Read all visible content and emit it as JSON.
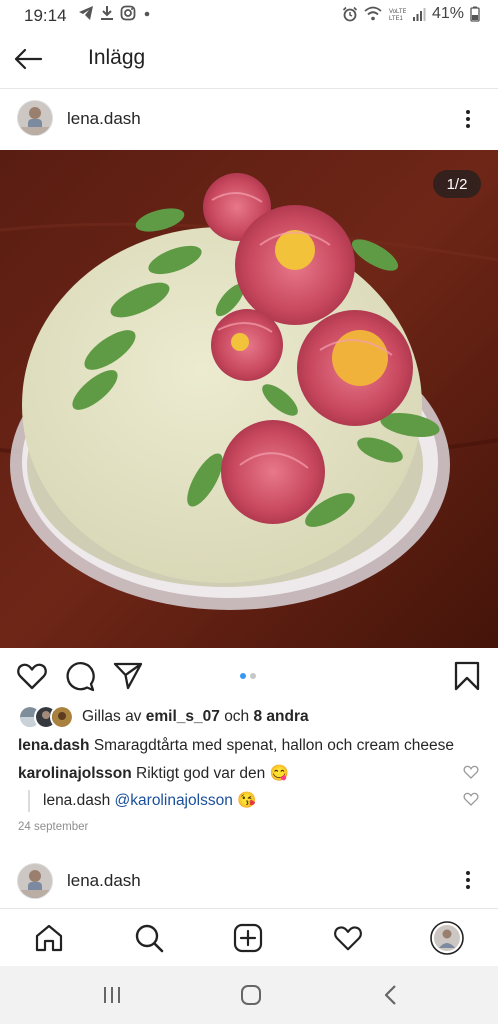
{
  "status_bar": {
    "time": "19:14",
    "battery": "41%",
    "left_icons": [
      "telegram-icon",
      "download-icon",
      "instagram-icon",
      "dot-icon"
    ],
    "right_icons": [
      "alarm-icon",
      "wifi-icon",
      "lte-icon",
      "signal-icon",
      "battery-icon"
    ]
  },
  "app_bar": {
    "title": "Inlägg",
    "back_icon": "arrow-left-icon"
  },
  "post": {
    "username": "lena.dash",
    "image_counter": "1/2",
    "image_subject": "cake with pink peony buttercream flowers",
    "carousel": {
      "count": 2,
      "active": 1,
      "active_color": "#3897f0",
      "inactive_color": "#c7c7c7"
    },
    "likes": {
      "prefix": "Gillas av",
      "user": "emil_s_07",
      "middle": "och",
      "others": "8 andra"
    },
    "caption": {
      "user": "lena.dash",
      "text": "Smaragdtårta med spenat, hallon och cream cheese"
    },
    "comments": [
      {
        "user": "karolinajolsson",
        "text": "Riktigt god var den",
        "emoji": "😋"
      }
    ],
    "reply": {
      "user": "lena.dash",
      "mention": "@karolinajolsson",
      "emoji": "😘"
    },
    "date": "24 september"
  },
  "next_post": {
    "username": "lena.dash"
  },
  "bottom_nav": [
    "home-icon",
    "search-icon",
    "add-post-icon",
    "activity-heart-icon",
    "profile-avatar"
  ],
  "system_nav": [
    "recent-apps-icon",
    "home-circle-icon",
    "back-chevron-icon"
  ],
  "colors": {
    "accent_blue": "#3897f0",
    "mention_blue": "#1b4f9c",
    "text": "#262626",
    "muted": "#8e8e8e"
  }
}
